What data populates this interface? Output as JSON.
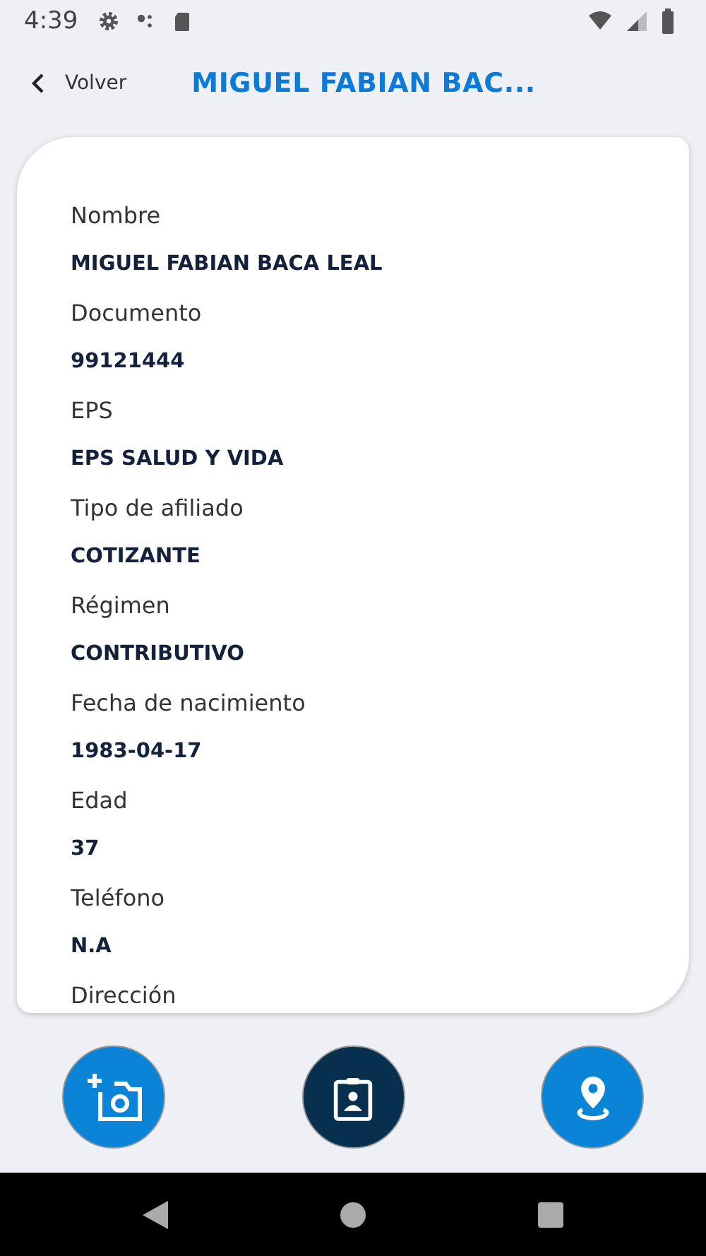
{
  "status_bar": {
    "time": "4:39"
  },
  "header": {
    "back_label": "Volver",
    "title": "MIGUEL FABIAN BAC..."
  },
  "fields": [
    {
      "label": "Nombre",
      "value": "MIGUEL FABIAN BACA LEAL"
    },
    {
      "label": "Documento",
      "value": "99121444"
    },
    {
      "label": "EPS",
      "value": "EPS SALUD Y VIDA"
    },
    {
      "label": "Tipo de afiliado",
      "value": "COTIZANTE"
    },
    {
      "label": "Régimen",
      "value": "CONTRIBUTIVO"
    },
    {
      "label": "Fecha de nacimiento",
      "value": "1983-04-17"
    },
    {
      "label": "Edad",
      "value": "37"
    },
    {
      "label": "Teléfono",
      "value": "N.A"
    },
    {
      "label": "Dirección"
    }
  ],
  "actions": [
    {
      "kind": "camera",
      "selected": false
    },
    {
      "kind": "badge",
      "selected": true
    },
    {
      "kind": "location",
      "selected": false
    }
  ]
}
